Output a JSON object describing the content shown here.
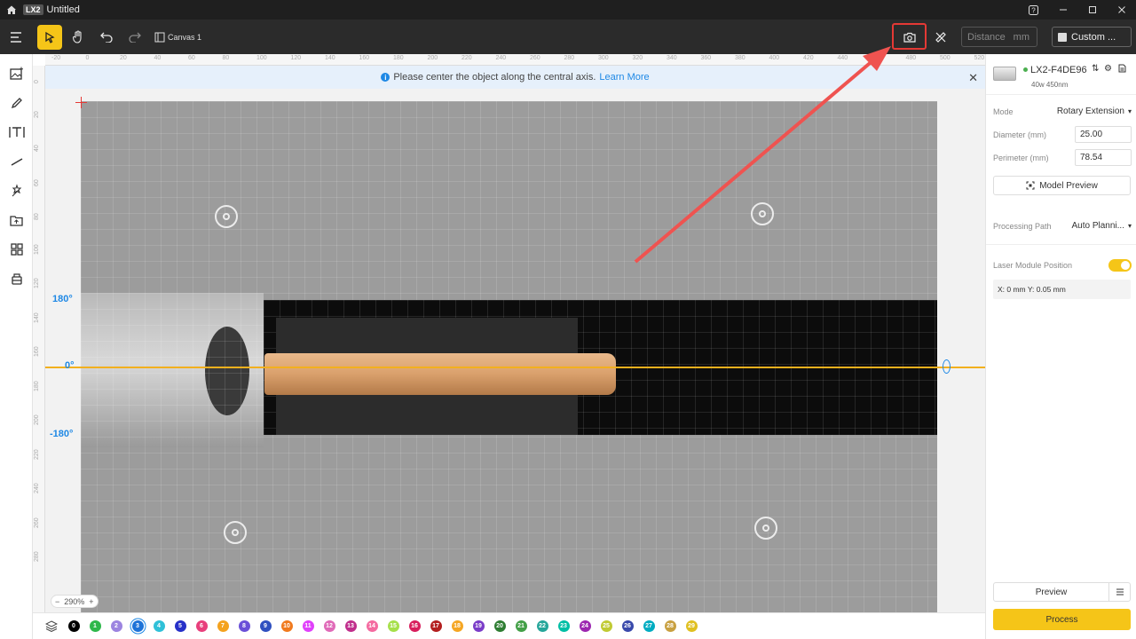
{
  "titlebar": {
    "badge": "LX2",
    "title": "Untitled"
  },
  "toolbar": {
    "canvas_label": "Canvas 1",
    "distance_placeholder": "Distance",
    "distance_unit": "mm",
    "custom_label": "Custom ..."
  },
  "ruler": {
    "top": [
      "-20",
      "0",
      "20",
      "40",
      "60",
      "80",
      "100",
      "120",
      "140",
      "160",
      "180",
      "200",
      "220",
      "240",
      "260",
      "280",
      "300",
      "320",
      "340",
      "360",
      "380",
      "400",
      "420",
      "440",
      "460",
      "480",
      "500",
      "520"
    ],
    "left": [
      "0",
      "20",
      "40",
      "60",
      "80",
      "100",
      "120",
      "140",
      "160",
      "180",
      "200",
      "220",
      "240",
      "260",
      "280"
    ]
  },
  "banner": {
    "text": "Please center the object along the central axis.",
    "link": "Learn More"
  },
  "canvas": {
    "deg_top": "180°",
    "deg_mid": "0°",
    "deg_bottom": "-180°",
    "zoom": "290%"
  },
  "layers": [
    {
      "n": "0",
      "color": "#000000"
    },
    {
      "n": "1",
      "color": "#2eb84b"
    },
    {
      "n": "2",
      "color": "#9c84e0"
    },
    {
      "n": "3",
      "color": "#1e73d8"
    },
    {
      "n": "4",
      "color": "#2fc0d8"
    },
    {
      "n": "5",
      "color": "#2630c8"
    },
    {
      "n": "6",
      "color": "#e83f7c"
    },
    {
      "n": "7",
      "color": "#f4a21e"
    },
    {
      "n": "8",
      "color": "#6a50d8"
    },
    {
      "n": "9",
      "color": "#2f50c0"
    },
    {
      "n": "10",
      "color": "#f07a1e"
    },
    {
      "n": "11",
      "color": "#e040fb"
    },
    {
      "n": "12",
      "color": "#e06ab8"
    },
    {
      "n": "13",
      "color": "#c02e8c"
    },
    {
      "n": "14",
      "color": "#f46aa0"
    },
    {
      "n": "15",
      "color": "#a6e04a"
    },
    {
      "n": "16",
      "color": "#d81e5c"
    },
    {
      "n": "17",
      "color": "#b31e1e"
    },
    {
      "n": "18",
      "color": "#f5a623"
    },
    {
      "n": "19",
      "color": "#7a3cc8"
    },
    {
      "n": "20",
      "color": "#2e7d32"
    },
    {
      "n": "21",
      "color": "#43a047"
    },
    {
      "n": "22",
      "color": "#26a69a"
    },
    {
      "n": "23",
      "color": "#00bfa5"
    },
    {
      "n": "24",
      "color": "#9c27b0"
    },
    {
      "n": "25",
      "color": "#c0ca33"
    },
    {
      "n": "26",
      "color": "#3949ab"
    },
    {
      "n": "27",
      "color": "#00acc1"
    },
    {
      "n": "28",
      "color": "#c8a040"
    },
    {
      "n": "29",
      "color": "#e0c020"
    }
  ],
  "active_layer": "3",
  "device": {
    "name": "LX2-F4DE96",
    "spec": "40w 450nm"
  },
  "panel": {
    "mode_label": "Mode",
    "mode_value": "Rotary Extension",
    "diameter_label": "Diameter  (mm)",
    "diameter_value": "25.00",
    "perimeter_label": "Perimeter  (mm)",
    "perimeter_value": "78.54",
    "model_preview": "Model Preview",
    "path_label": "Processing Path",
    "path_value": "Auto Planni...",
    "laser_label": "Laser Module Position",
    "position_text": "X: 0 mm  Y: 0.05 mm",
    "preview": "Preview",
    "process": "Process"
  },
  "colors": {
    "accent": "#f5c518",
    "axis": "#f2b01e",
    "info": "#1e88e5",
    "highlight": "#e53935"
  }
}
